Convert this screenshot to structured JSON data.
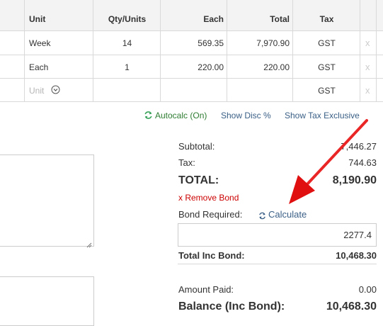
{
  "table": {
    "headers": {
      "unit": "Unit",
      "qty": "Qty/Units",
      "each": "Each",
      "total": "Total",
      "tax": "Tax"
    },
    "rows": [
      {
        "unit": "Week",
        "qty": "14",
        "each": "569.35",
        "total": "7,970.90",
        "tax": "GST",
        "remove": "x"
      },
      {
        "unit": "Each",
        "qty": "1",
        "each": "220.00",
        "total": "220.00",
        "tax": "GST",
        "remove": "x"
      }
    ],
    "new_row": {
      "unit_placeholder": "Unit",
      "tax": "GST",
      "remove": "x"
    }
  },
  "toolbar": {
    "autocalc_label": "Autocalc (On)",
    "show_disc_label": "Show Disc %",
    "show_tax_exclusive_label": "Show Tax Exclusive"
  },
  "totals": {
    "subtotal_label": "Subtotal:",
    "subtotal_value": "7,446.27",
    "tax_label": "Tax:",
    "tax_value": "744.63",
    "total_label": "TOTAL:",
    "total_value": "8,190.90",
    "remove_bond_label": "x Remove Bond",
    "bond_required_label": "Bond Required:",
    "calculate_label": "Calculate",
    "bond_value": "2277.4",
    "total_inc_bond_label": "Total Inc Bond:",
    "total_inc_bond_value": "10,468.30",
    "amount_paid_label": "Amount Paid:",
    "amount_paid_value": "0.00",
    "balance_label": "Balance (Inc Bond):",
    "balance_value": "10,468.30"
  },
  "colors": {
    "link": "#3a5f86",
    "autocalc_icon": "#3aa35b",
    "autocalc_text": "#2e7d32",
    "remove_bond": "#cc0000",
    "arrow": "#e01010"
  }
}
